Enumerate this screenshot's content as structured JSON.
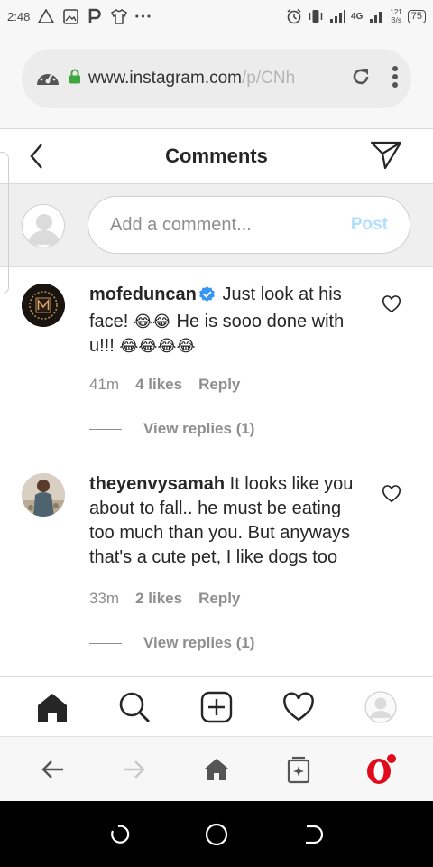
{
  "status_bar": {
    "time": "2:48",
    "network_speed_value": "121",
    "network_speed_unit": "B/s",
    "network_type": "4G",
    "battery": "75"
  },
  "browser": {
    "url_main": "www.instagram.com",
    "url_path": "/p/CNh"
  },
  "header": {
    "title": "Comments"
  },
  "add_comment": {
    "placeholder": "Add a comment...",
    "post_label": "Post"
  },
  "comments": [
    {
      "username": "mofeduncan",
      "verified": true,
      "text_1": " Just look at his face! ",
      "emoji_1": "😂😂",
      "text_2": " He is sooo done with u!!! ",
      "emoji_2": "😂😂😂😂",
      "time": "41m",
      "likes": "4 likes",
      "reply_label": "Reply",
      "view_replies": "View replies (1)"
    },
    {
      "username": "theyenvysamah",
      "verified": false,
      "text_1": " It looks like you about to fall.. he must be eating too much than you. But anyways that's a cute pet, I like dogs too",
      "time": "33m",
      "likes": "2 likes",
      "reply_label": "Reply",
      "view_replies": "View replies (1)"
    }
  ],
  "ig_nav": [
    "home-icon",
    "search-icon",
    "add-icon",
    "heart-icon",
    "profile-icon"
  ],
  "browser_nav": [
    "back-icon",
    "forward-icon",
    "home-icon",
    "tabs-icon",
    "opera-icon"
  ],
  "colors": {
    "verified": "#3897f0",
    "post_disabled": "#b2dffc",
    "opera_red": "#e00b1c",
    "secondary_text": "#8e8e8e"
  }
}
